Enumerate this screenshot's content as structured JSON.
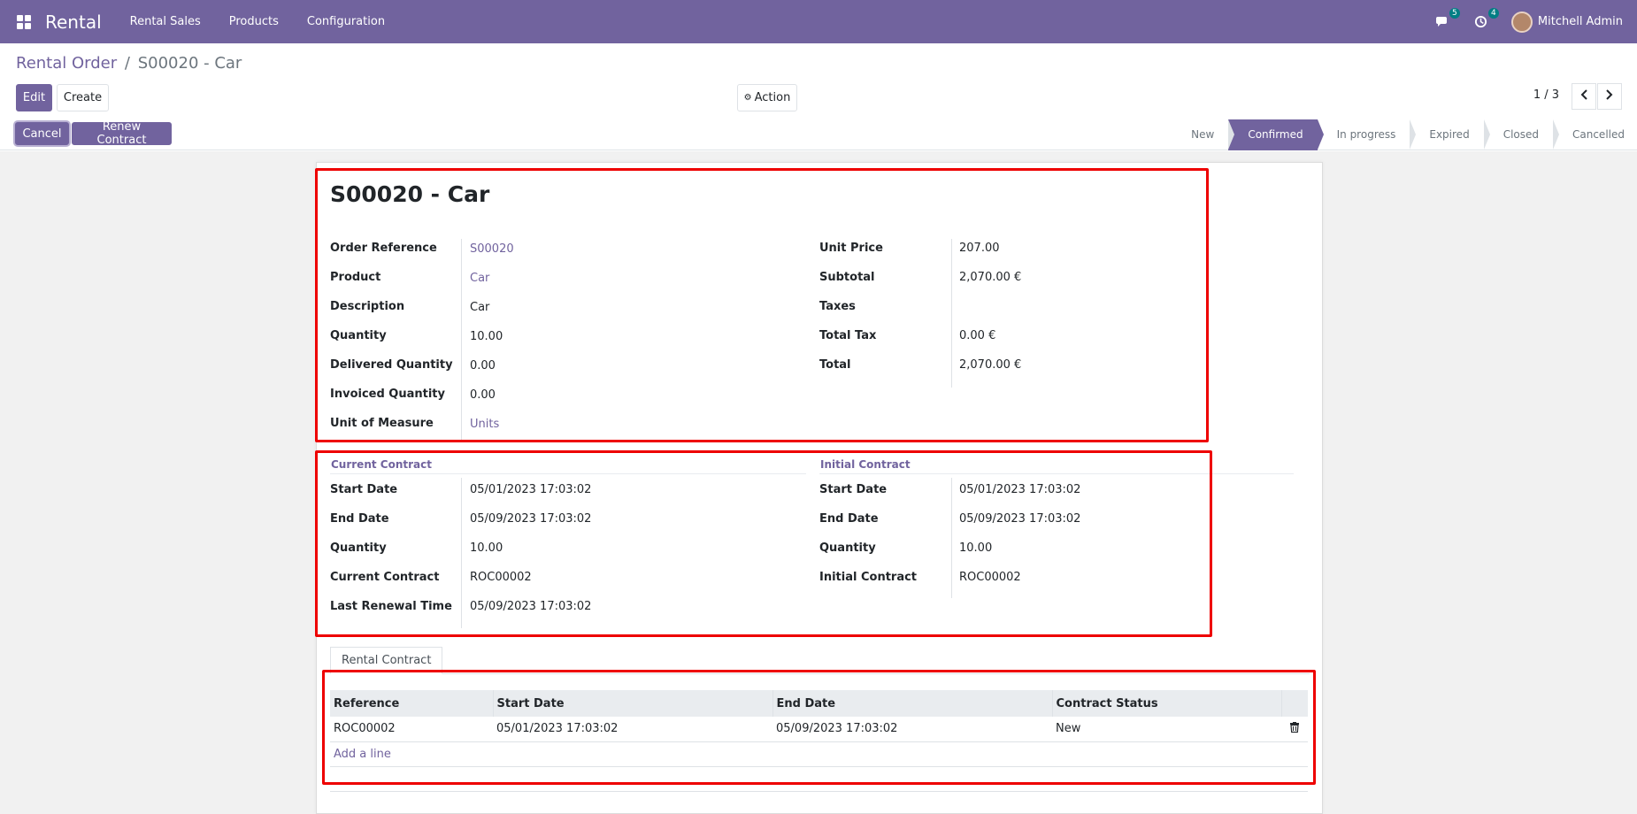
{
  "navbar": {
    "brand": "Rental",
    "menu": [
      "Rental Sales",
      "Products",
      "Configuration"
    ],
    "messages_count": "5",
    "activities_count": "4",
    "user_name": "Mitchell Admin"
  },
  "breadcrumb": {
    "parent": "Rental Order",
    "separator": "/",
    "current": "S00020 - Car"
  },
  "toolbar": {
    "edit_label": "Edit",
    "create_label": "Create",
    "action_label": "Action",
    "pager": "1 / 3"
  },
  "header_buttons": {
    "cancel_label": "Cancel",
    "renew_label": "Renew Contract"
  },
  "statusbar": {
    "stages": [
      "New",
      "Confirmed",
      "In progress",
      "Expired",
      "Closed",
      "Cancelled"
    ],
    "active": "Confirmed"
  },
  "record": {
    "title": "S00020 - Car",
    "left_fields": [
      {
        "label": "Order Reference",
        "value": "S00020",
        "link": true
      },
      {
        "label": "Product",
        "value": "Car",
        "link": true
      },
      {
        "label": "Description",
        "value": "Car",
        "link": false
      },
      {
        "label": "Quantity",
        "value": "10.00",
        "link": false
      },
      {
        "label": "Delivered Quantity",
        "value": "0.00",
        "link": false
      },
      {
        "label": "Invoiced Quantity",
        "value": "0.00",
        "link": false
      },
      {
        "label": "Unit of Measure",
        "value": "Units",
        "link": true
      }
    ],
    "right_fields": [
      {
        "label": "Unit Price",
        "value": "207.00"
      },
      {
        "label": "Subtotal",
        "value": "2,070.00 €"
      },
      {
        "label": "Taxes",
        "value": ""
      },
      {
        "label": "Total Tax",
        "value": "0.00 €"
      },
      {
        "label": "Total",
        "value": "2,070.00 €"
      }
    ]
  },
  "current_contract": {
    "title": "Current Contract",
    "fields": [
      {
        "label": "Start Date",
        "value": "05/01/2023 17:03:02"
      },
      {
        "label": "End Date",
        "value": "05/09/2023 17:03:02"
      },
      {
        "label": "Quantity",
        "value": "10.00"
      },
      {
        "label": "Current Contract",
        "value": "ROC00002"
      },
      {
        "label": "Last Renewal Time",
        "value": "05/09/2023 17:03:02"
      }
    ]
  },
  "initial_contract": {
    "title": "Initial Contract",
    "fields": [
      {
        "label": "Start Date",
        "value": "05/01/2023 17:03:02"
      },
      {
        "label": "End Date",
        "value": "05/09/2023 17:03:02"
      },
      {
        "label": "Quantity",
        "value": "10.00"
      },
      {
        "label": "Initial Contract",
        "value": "ROC00002"
      }
    ]
  },
  "tabs": {
    "rental_contract": "Rental Contract"
  },
  "contract_lines": {
    "headers": [
      "Reference",
      "Start Date",
      "End Date",
      "Contract Status"
    ],
    "rows": [
      [
        "ROC00002",
        "05/01/2023 17:03:02",
        "05/09/2023 17:03:02",
        "New"
      ]
    ],
    "add_line": "Add a line"
  },
  "colors": {
    "brand": "#71639e",
    "highlight_box": "#ee0000"
  }
}
